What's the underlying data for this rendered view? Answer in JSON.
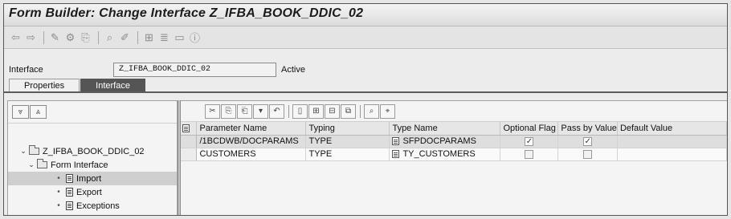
{
  "window": {
    "title": "Form Builder: Change Interface Z_IFBA_BOOK_DDIC_02"
  },
  "toolbar": {
    "icons": [
      "back-arrow-icon",
      "forward-arrow-icon",
      "other-object-icon",
      "display-change-icon",
      "activate-icon",
      "where-used-icon",
      "pencil-icon",
      "hierarchy-icon",
      "align-icon",
      "window-icon",
      "info-icon"
    ]
  },
  "interface": {
    "label": "Interface",
    "name": "Z_IFBA_BOOK_DDIC_02",
    "status": "Active"
  },
  "tabs": [
    {
      "label": "Properties",
      "active": false
    },
    {
      "label": "Interface",
      "active": true
    }
  ],
  "tree": {
    "root": "Z_IFBA_BOOK_DDIC_02",
    "form_interface": "Form Interface",
    "import": "Import",
    "export": "Export",
    "exceptions": "Exceptions"
  },
  "table": {
    "columns": [
      "Parameter Name",
      "Typing",
      "Type Name",
      "Optional Flag",
      "Pass by Value",
      "Default Value"
    ],
    "rows": [
      {
        "param": "/1BCDWB/DOCPARAMS",
        "typing": "TYPE",
        "type_name": "SFPDOCPARAMS",
        "optional": true,
        "by_value": true,
        "default": ""
      },
      {
        "param": "CUSTOMERS",
        "typing": "TYPE",
        "type_name": "TY_CUSTOMERS",
        "optional": false,
        "by_value": false,
        "default": ""
      }
    ]
  },
  "colors": {
    "active_tab": "#555555",
    "selection": "#cfcfcf"
  }
}
